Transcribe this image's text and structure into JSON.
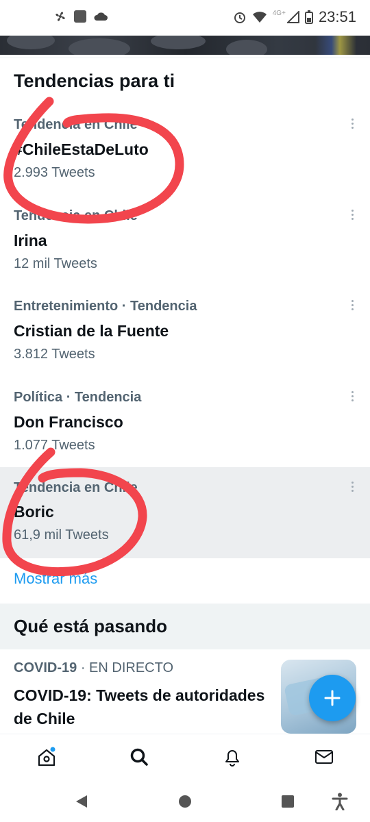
{
  "status_bar": {
    "time": "23:51",
    "network": "4G+"
  },
  "trends_section": {
    "title": "Tendencias para ti",
    "items": [
      {
        "context": "Tendencia en Chile",
        "name": "#ChileEstaDeLuto",
        "count": "2.993 Tweets",
        "highlighted": false
      },
      {
        "context": "Tendencia en Chile",
        "name": "Irina",
        "count": "12 mil Tweets",
        "highlighted": false
      },
      {
        "context": "Entretenimiento · Tendencia",
        "name": "Cristian de la Fuente",
        "count": "3.812 Tweets",
        "highlighted": false
      },
      {
        "context": "Política · Tendencia",
        "name": "Don Francisco",
        "count": "1.077 Tweets",
        "highlighted": false
      },
      {
        "context": "Tendencia en Chile",
        "name": "Boric",
        "count": "61,9 mil Tweets",
        "highlighted": true
      }
    ],
    "show_more": "Mostrar más"
  },
  "happening_section": {
    "title": "Qué está pasando",
    "news": {
      "category": "COVID-19",
      "tag": "· EN DIRECTO",
      "title": "COVID-19: Tweets de autoridades de Chile"
    }
  },
  "bottom_nav": {
    "items": [
      "home-icon",
      "search-icon",
      "bell-icon",
      "mail-icon"
    ],
    "home_has_notification": true
  },
  "colors": {
    "accent": "#1d9bf0",
    "annotation": "#f2454d",
    "secondary_text": "#536471"
  }
}
